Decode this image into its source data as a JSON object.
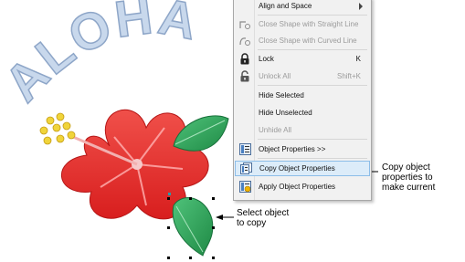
{
  "menu": {
    "items": [
      {
        "label": "Align and Space",
        "shortcut": "",
        "disabled": false,
        "icon": "none",
        "submenu": true
      },
      {
        "label": "Close Shape with Straight Line",
        "shortcut": "",
        "disabled": true,
        "icon": "close-straight-icon"
      },
      {
        "label": "Close Shape with Curved Line",
        "shortcut": "",
        "disabled": true,
        "icon": "close-curved-icon"
      },
      {
        "label": "Lock",
        "shortcut": "K",
        "disabled": false,
        "icon": "lock-icon"
      },
      {
        "label": "Unlock All",
        "shortcut": "Shift+K",
        "disabled": true,
        "icon": "unlock-icon"
      },
      {
        "label": "Hide Selected",
        "shortcut": "",
        "disabled": false,
        "icon": "none"
      },
      {
        "label": "Hide Unselected",
        "shortcut": "",
        "disabled": false,
        "icon": "none"
      },
      {
        "label": "Unhide All",
        "shortcut": "",
        "disabled": true,
        "icon": "none"
      },
      {
        "label": "Object Properties >>",
        "shortcut": "",
        "disabled": false,
        "icon": "object-properties-icon"
      },
      {
        "label": "Copy Object Properties",
        "shortcut": "",
        "disabled": false,
        "icon": "copy-properties-icon",
        "highlighted": true
      },
      {
        "label": "Apply Object Properties",
        "shortcut": "",
        "disabled": false,
        "icon": "apply-properties-icon"
      }
    ]
  },
  "callouts": {
    "copy": "Copy object\nproperties to\nmake current",
    "select": "Select object\nto copy"
  },
  "artwork": {
    "title_text": "ALOHA"
  },
  "colors": {
    "menu_bg": "#f1f1f1",
    "highlight": "#dcecf9",
    "highlight_border": "#8cbde8",
    "disabled_text": "#9b9b9b",
    "flower_red": "#e8302e",
    "leaf_green": "#2e9e55",
    "stamen_yellow": "#f0d43a",
    "aloha_blue": "#b9cde6"
  }
}
